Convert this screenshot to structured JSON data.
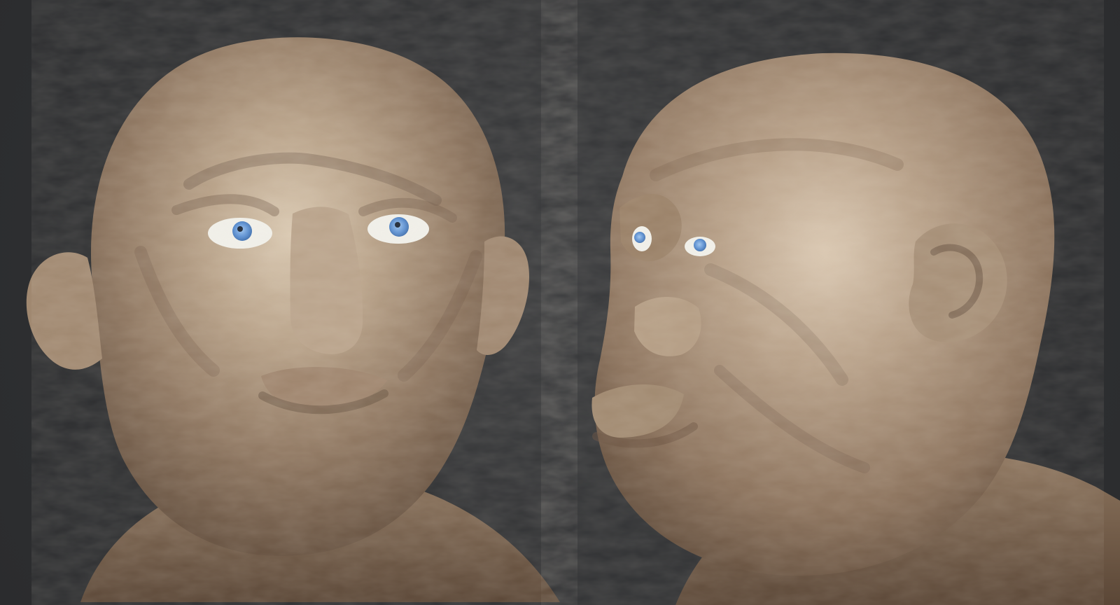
{
  "scene": {
    "views": [
      {
        "view": "front"
      },
      {
        "view": "side"
      }
    ],
    "colors": {
      "background": "#2f3032",
      "skin_base": "#a58f74",
      "skin_highlight": "#e6d8c4",
      "skin_shadow": "#4a3b2e",
      "iris": "#5b8fd1",
      "sclera": "#f0efe9"
    }
  }
}
